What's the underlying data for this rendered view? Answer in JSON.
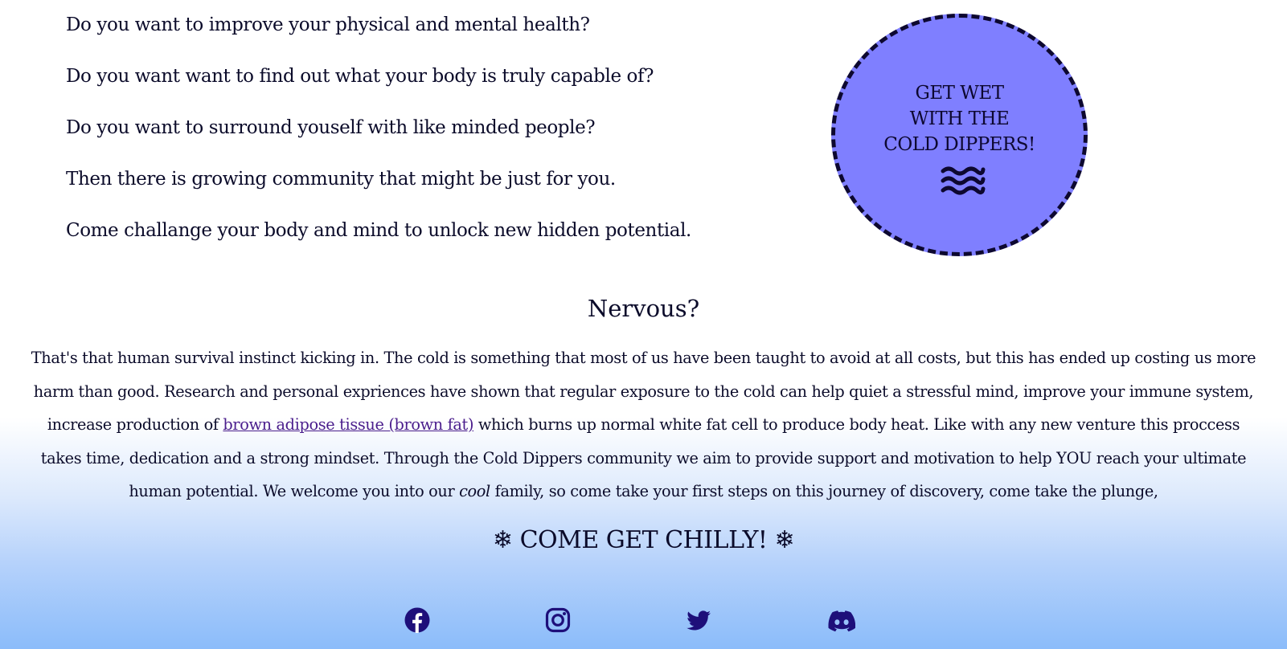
{
  "intro": {
    "questions": [
      "Do you want to improve your physical and mental health?",
      "Do you want want to find out what your body is truly capable of?",
      "Do you want to surround youself with like minded people?",
      "Then there is growing community that might be just for you.",
      "Come challange your body and mind to unlock new hidden potential."
    ]
  },
  "badge": {
    "line1": "GET WET",
    "line2": "WITH THE",
    "line3": "COLD DIPPERS!",
    "icon": "waves-icon",
    "fill_color": "#7f7fff"
  },
  "nervous": {
    "title": "Nervous?",
    "paragraph_before_link": "That's that human survival instinct kicking in. The cold is something that most of us have been taught to avoid at all costs, but this has ended up costing us more harm than good. Research and personal expriences have shown that regular exposure to the cold can help quiet a stressful mind, improve your immune system, increase production of ",
    "link_text": "brown adipose tissue (brown fat)",
    "paragraph_after_link": " which burns up normal white fat cell to produce body heat. Like with any new venture this proccess takes time, dedication and a strong mindset. Through the Cold Dippers community we aim to provide support and motivation to help YOU reach your ultimate human potential. We welcome you into our ",
    "emphasis": "cool",
    "paragraph_end": " family, so come take your first steps on this journey of discovery, come take the plunge,"
  },
  "cta": {
    "snowflake": "❄",
    "text": "COME GET CHILLY!"
  },
  "social": [
    {
      "icon": "facebook-icon"
    },
    {
      "icon": "instagram-icon"
    },
    {
      "icon": "twitter-icon"
    },
    {
      "icon": "discord-icon"
    }
  ],
  "colors": {
    "text": "#0b0b2a",
    "link": "#4a1d8c",
    "icon": "#1e0f7a",
    "footer_gradient_bottom": "#8bbcfa"
  }
}
